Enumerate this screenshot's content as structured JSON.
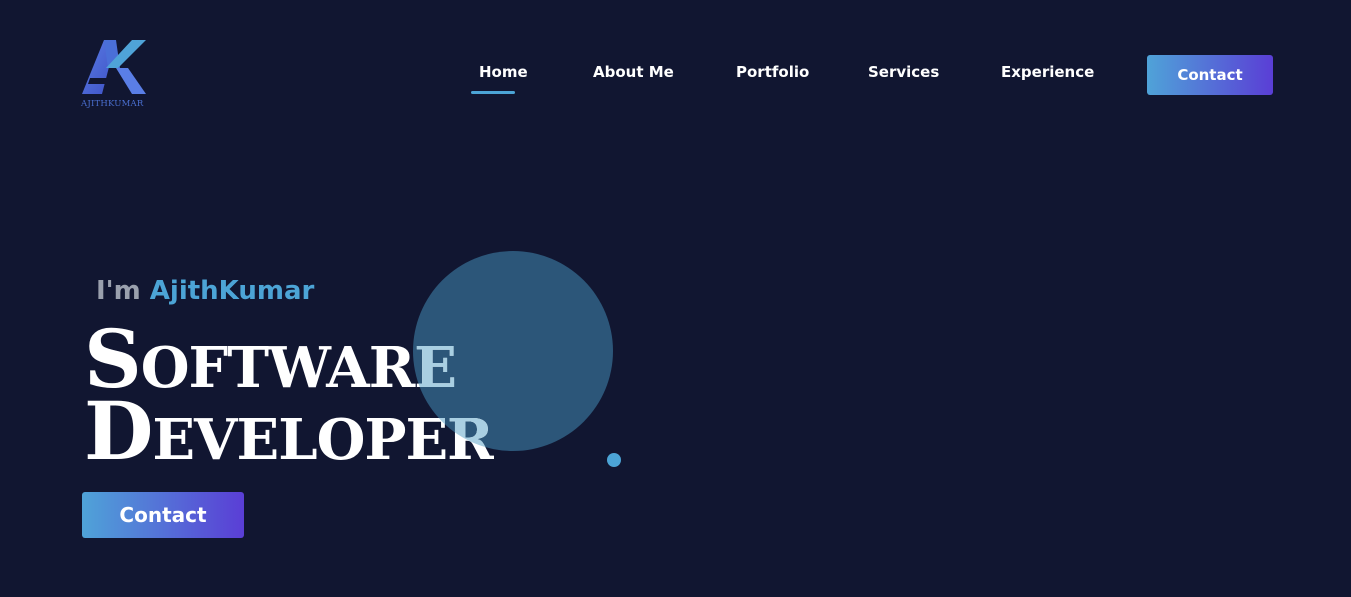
{
  "logo": {
    "text": "AJITHKUMAR",
    "icon": "ak-logo-icon"
  },
  "nav": {
    "items": [
      {
        "label": "Home",
        "active": true
      },
      {
        "label": "About Me"
      },
      {
        "label": "Portfolio"
      },
      {
        "label": "Services"
      },
      {
        "label": "Experience"
      }
    ],
    "contact_label": "Contact"
  },
  "hero": {
    "greeting_prefix": "I'm",
    "name": "AjithKumar",
    "headline_line1": "Software",
    "headline_line2": "Developer",
    "contact_label": "Contact"
  },
  "colors": {
    "background": "#111631",
    "accent": "#4ca4d6",
    "gradient_start": "#4fa3d8",
    "gradient_end": "#5a3ed6",
    "circle": "#2c5679"
  }
}
